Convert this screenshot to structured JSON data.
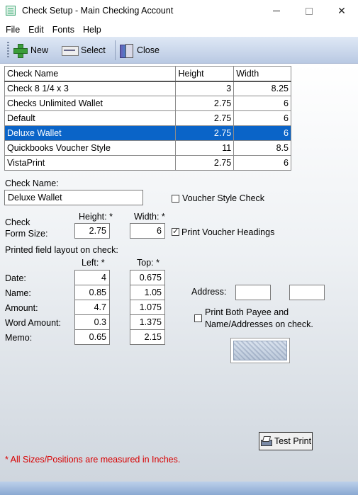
{
  "window": {
    "title": "Check Setup - Main Checking Account"
  },
  "menu": {
    "file": "File",
    "edit": "Edit",
    "fonts": "Fonts",
    "help": "Help"
  },
  "toolbar": {
    "new_label": "New",
    "select_label": "Select",
    "close_label": "Close"
  },
  "table": {
    "headers": [
      "Check Name",
      "Height",
      "Width"
    ],
    "rows": [
      {
        "name": "Check 8 1/4 x 3",
        "height": "3",
        "width": "8.25"
      },
      {
        "name": "Checks Unlimited Wallet",
        "height": "2.75",
        "width": "6"
      },
      {
        "name": "Default",
        "height": "2.75",
        "width": "6"
      },
      {
        "name": "Deluxe Wallet",
        "height": "2.75",
        "width": "6"
      },
      {
        "name": "Quickbooks Voucher Style",
        "height": "11",
        "width": "8.5"
      },
      {
        "name": "VistaPrint",
        "height": "2.75",
        "width": "6"
      }
    ],
    "selected_index": 3
  },
  "form": {
    "check_name_label": "Check Name:",
    "check_name_value": "Deluxe Wallet",
    "voucher_style_label": "Voucher Style Check",
    "voucher_style_checked": false,
    "check_form_size_label_1": "Check",
    "check_form_size_label_2": "Form Size:",
    "height_label": "Height: *",
    "width_label": "Width: *",
    "height_value": "2.75",
    "width_value": "6",
    "print_voucher_headings_label": "Print Voucher Headings",
    "print_voucher_headings_checked": true,
    "layout_label": "Printed field layout on check:",
    "left_label": "Left: *",
    "top_label": "Top: *",
    "fields": [
      {
        "label": "Date:",
        "left": "4",
        "top": "0.675"
      },
      {
        "label": "Name:",
        "left": "0.85",
        "top": "1.05"
      },
      {
        "label": "Amount:",
        "left": "4.7",
        "top": "1.075"
      },
      {
        "label": "Word Amount:",
        "left": "0.3",
        "top": "1.375"
      },
      {
        "label": "Memo:",
        "left": "0.65",
        "top": "2.15"
      }
    ],
    "address_label": "Address:",
    "address_left": "",
    "address_top": "",
    "print_both_label_1": "Print Both Payee and",
    "print_both_label_2": "Name/Addresses on check.",
    "print_both_checked": false,
    "test_print_label": "Test Print",
    "note": "* All Sizes/Positions are measured in Inches."
  },
  "colors": {
    "selection": "#0a64c8",
    "note": "#d80000",
    "toolbar": "#c9d6ec"
  }
}
